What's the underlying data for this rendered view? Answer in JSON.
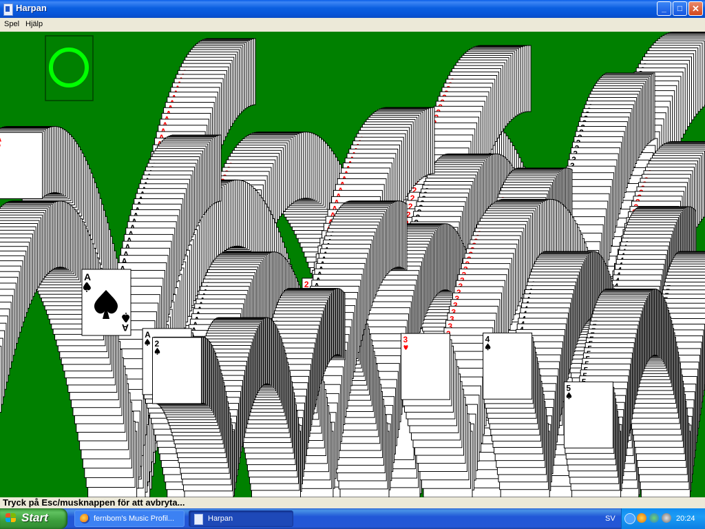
{
  "window": {
    "title": "Harpan",
    "minimize_glyph": "_",
    "maximize_glyph": "□",
    "close_glyph": "✕"
  },
  "menu": {
    "items": [
      "Spel",
      "Hjälp"
    ]
  },
  "game": {
    "name": "Harpan",
    "state": "win-animation",
    "stock_empty_marker": "circle-icon",
    "felt_color": "#008000",
    "marker_color": "#00ff00",
    "red_suit_color": "#ff0000",
    "cards_drawn": [
      {
        "rank": "A",
        "suit": "spade"
      },
      {
        "rank": "A",
        "suit": "heart"
      },
      {
        "rank": "2",
        "suit": "heart"
      },
      {
        "rank": "2",
        "suit": "spade"
      },
      {
        "rank": "3",
        "suit": "spade"
      },
      {
        "rank": "3",
        "suit": "heart"
      },
      {
        "rank": "4",
        "suit": "spade"
      },
      {
        "rank": "5",
        "suit": "spade"
      }
    ]
  },
  "status": {
    "text": "Tryck på Esc/musknappen för att avbryta..."
  },
  "taskbar": {
    "start_label": "Start",
    "tasks": [
      {
        "label": "fernbom's Music Profil...",
        "icon": "firefox-icon",
        "active": false
      },
      {
        "label": "Harpan",
        "icon": "harpan-icon",
        "active": true
      }
    ],
    "language": "SV",
    "clock": "20:24"
  }
}
